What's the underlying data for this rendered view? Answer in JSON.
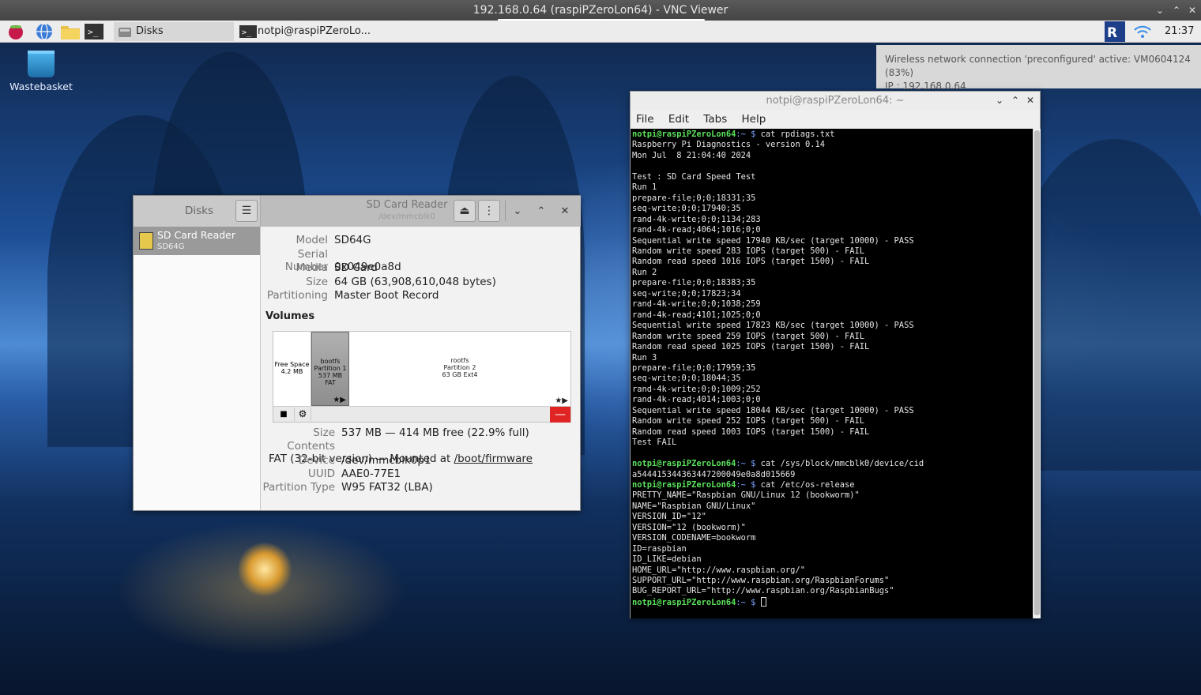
{
  "vnc": {
    "title": "192.168.0.64 (raspiPZeroLon64) - VNC Viewer"
  },
  "panel": {
    "tasks": [
      {
        "label": "Disks",
        "icon": "disks-icon"
      },
      {
        "label": "notpi@raspiPZeroLo...",
        "icon": "terminal-icon"
      }
    ],
    "clock": "21:37"
  },
  "notification": {
    "line1": "Wireless network connection 'preconfigured' active: VM0604124 (83%)",
    "line2": "IP : 192.168.0.64"
  },
  "desktop": {
    "wastebasket_label": "Wastebasket"
  },
  "disks": {
    "sidebar_title": "Disks",
    "device": {
      "name": "SD Card Reader",
      "sub": "SD64G"
    },
    "header": {
      "title": "SD Card Reader",
      "subtitle": "/dev/mmcblk0"
    },
    "drive_info": [
      {
        "label": "Model",
        "value": "SD64G"
      },
      {
        "label": "Serial Number",
        "value": "0x049e0a8d"
      },
      {
        "label": "Media",
        "value": "SD Card"
      },
      {
        "label": "Size",
        "value": "64 GB (63,908,610,048 bytes)"
      },
      {
        "label": "Partitioning",
        "value": "Master Boot Record"
      }
    ],
    "volumes_heading": "Volumes",
    "volumes": [
      {
        "l1": "Free Space",
        "l2": "4.2 MB",
        "l3": ""
      },
      {
        "l1": "bootfs",
        "l2": "Partition 1",
        "l3": "537 MB FAT"
      },
      {
        "l1": "rootfs",
        "l2": "Partition 2",
        "l3": "63 GB Ext4"
      }
    ],
    "partition_info": [
      {
        "label": "Size",
        "value": "537 MB — 414 MB free (22.9% full)"
      },
      {
        "label": "Contents",
        "value": "FAT (32-bit version) — Mounted at ",
        "link": "/boot/firmware"
      },
      {
        "label": "Device",
        "value": "/dev/mmcblk0p1"
      },
      {
        "label": "UUID",
        "value": "AAE0-77E1"
      },
      {
        "label": "Partition Type",
        "value": "W95 FAT32 (LBA)"
      }
    ]
  },
  "terminal": {
    "title": "notpi@raspiPZeroLon64: ~",
    "menu": [
      "File",
      "Edit",
      "Tabs",
      "Help"
    ],
    "prompt": "notpi@raspiPZeroLon64",
    "lines": [
      {
        "cmd": "cat rpdiags.txt"
      },
      {
        "out": "Raspberry Pi Diagnostics - version 0.14"
      },
      {
        "out": "Mon Jul  8 21:04:40 2024"
      },
      {
        "out": ""
      },
      {
        "out": "Test : SD Card Speed Test"
      },
      {
        "out": "Run 1"
      },
      {
        "out": "prepare-file;0;0;18331;35"
      },
      {
        "out": "seq-write;0;0;17940;35"
      },
      {
        "out": "rand-4k-write;0;0;1134;283"
      },
      {
        "out": "rand-4k-read;4064;1016;0;0"
      },
      {
        "out": "Sequential write speed 17940 KB/sec (target 10000) - PASS"
      },
      {
        "out": "Random write speed 283 IOPS (target 500) - FAIL"
      },
      {
        "out": "Random read speed 1016 IOPS (target 1500) - FAIL"
      },
      {
        "out": "Run 2"
      },
      {
        "out": "prepare-file;0;0;18383;35"
      },
      {
        "out": "seq-write;0;0;17823;34"
      },
      {
        "out": "rand-4k-write;0;0;1038;259"
      },
      {
        "out": "rand-4k-read;4101;1025;0;0"
      },
      {
        "out": "Sequential write speed 17823 KB/sec (target 10000) - PASS"
      },
      {
        "out": "Random write speed 259 IOPS (target 500) - FAIL"
      },
      {
        "out": "Random read speed 1025 IOPS (target 1500) - FAIL"
      },
      {
        "out": "Run 3"
      },
      {
        "out": "prepare-file;0;0;17959;35"
      },
      {
        "out": "seq-write;0;0;18044;35"
      },
      {
        "out": "rand-4k-write;0;0;1009;252"
      },
      {
        "out": "rand-4k-read;4014;1003;0;0"
      },
      {
        "out": "Sequential write speed 18044 KB/sec (target 10000) - PASS"
      },
      {
        "out": "Random write speed 252 IOPS (target 500) - FAIL"
      },
      {
        "out": "Random read speed 1003 IOPS (target 1500) - FAIL"
      },
      {
        "out": "Test FAIL"
      },
      {
        "out": ""
      },
      {
        "cmd": "cat /sys/block/mmcblk0/device/cid"
      },
      {
        "out": "a544415344363447200049e0a8d015669"
      },
      {
        "cmd": "cat /etc/os-release"
      },
      {
        "out": "PRETTY_NAME=\"Raspbian GNU/Linux 12 (bookworm)\""
      },
      {
        "out": "NAME=\"Raspbian GNU/Linux\""
      },
      {
        "out": "VERSION_ID=\"12\""
      },
      {
        "out": "VERSION=\"12 (bookworm)\""
      },
      {
        "out": "VERSION_CODENAME=bookworm"
      },
      {
        "out": "ID=raspbian"
      },
      {
        "out": "ID_LIKE=debian"
      },
      {
        "out": "HOME_URL=\"http://www.raspbian.org/\""
      },
      {
        "out": "SUPPORT_URL=\"http://www.raspbian.org/RaspbianForums\""
      },
      {
        "out": "BUG_REPORT_URL=\"http://www.raspbian.org/RaspbianBugs\""
      },
      {
        "cmd": "",
        "cursor": true
      }
    ]
  }
}
